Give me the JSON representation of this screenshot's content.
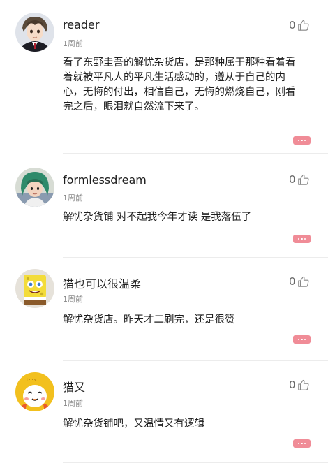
{
  "comments": [
    {
      "username": "reader",
      "time": "1周前",
      "likes": "0",
      "text": "看了东野圭吾的解忧杂货店，是那种属于那种看着看着就被平凡人的平凡生活感动的，遵从于自己的内心，无悔的付出，相信自己，无悔的燃烧自己，刚看完之后，眼泪就自然流下来了。",
      "avatar_icon": "anime-boy-avatar"
    },
    {
      "username": "formlessdream",
      "time": "1周前",
      "likes": "0",
      "text": "解忧杂货铺 对不起我今年才读 是我落伍了",
      "avatar_icon": "green-hair-girl-avatar"
    },
    {
      "username": "猫也可以很温柔",
      "time": "1周前",
      "likes": "0",
      "text": "解忧杂货店。昨天才二刷完，还是很赞",
      "avatar_icon": "spongebob-avatar"
    },
    {
      "username": "猫又",
      "time": "1周前",
      "likes": "0",
      "text": "解忧杂货铺吧，又温情又有逻辑",
      "avatar_icon": "cartoon-face-avatar"
    }
  ],
  "colors": {
    "reply_button": "#f08c97",
    "username": "#1e1e1e",
    "timestamp": "#8a8a8a",
    "divider": "#ececec"
  },
  "icons": {
    "like": "thumbs-up-icon",
    "reply": "reply-bubble-icon"
  }
}
